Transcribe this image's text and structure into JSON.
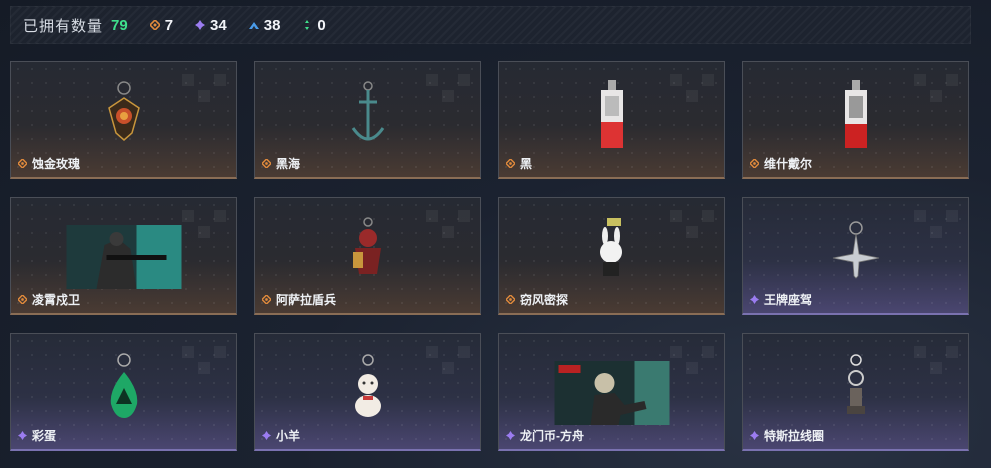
{
  "summary": {
    "owned_label": "已拥有数量",
    "owned_total": "79",
    "stats": [
      {
        "icon": "gold-diamond-icon",
        "color": "#e08a3c",
        "value": "7"
      },
      {
        "icon": "purple-diamond-icon",
        "color": "#9b7cf0",
        "value": "34"
      },
      {
        "icon": "blue-rarity-icon",
        "color": "#4a9be8",
        "value": "38"
      },
      {
        "icon": "green-rarity-icon",
        "color": "#3fe08c",
        "value": "0"
      }
    ]
  },
  "items": [
    {
      "name": "蚀金玫瑰",
      "rarity": "gold",
      "art": "rose-charm"
    },
    {
      "name": "黑海",
      "rarity": "gold",
      "art": "anchor-charm"
    },
    {
      "name": "黑",
      "rarity": "gold",
      "art": "card-charm"
    },
    {
      "name": "维什戴尔",
      "rarity": "gold",
      "art": "card-charm"
    },
    {
      "name": "凌霄戍卫",
      "rarity": "gold",
      "art": "soldier-banner"
    },
    {
      "name": "阿萨拉盾兵",
      "rarity": "gold",
      "art": "warrior-charm"
    },
    {
      "name": "窃风密探",
      "rarity": "gold",
      "art": "bunny-charm"
    },
    {
      "name": "王牌座驾",
      "rarity": "purple",
      "art": "jet-charm"
    },
    {
      "name": "彩蛋",
      "rarity": "purple",
      "art": "egg-charm"
    },
    {
      "name": "小羊",
      "rarity": "purple",
      "art": "sheep-charm"
    },
    {
      "name": "龙门币-方舟",
      "rarity": "purple",
      "art": "zombie-banner"
    },
    {
      "name": "特斯拉线圈",
      "rarity": "purple",
      "art": "tesla-charm"
    }
  ]
}
